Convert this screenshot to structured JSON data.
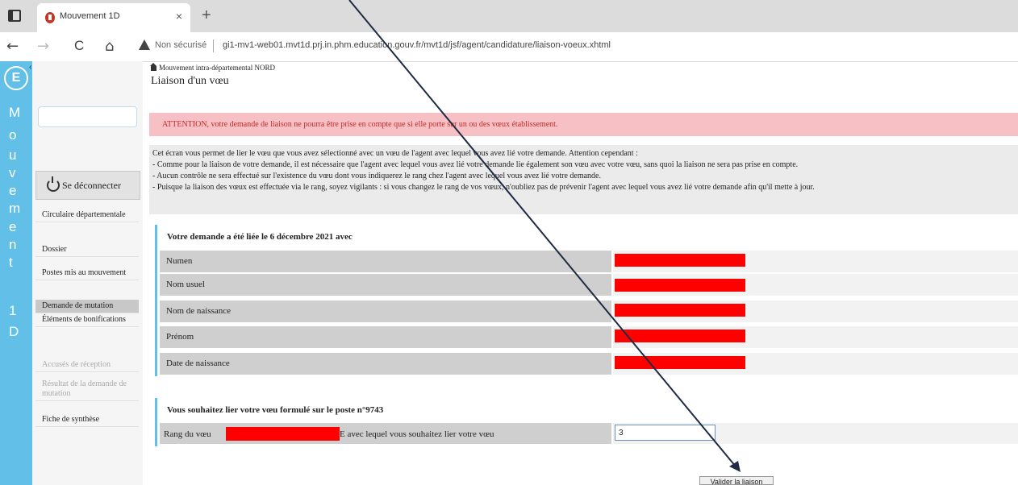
{
  "browser": {
    "tab_title": "Mouvement 1D",
    "tab_close": "×",
    "new_tab": "+",
    "nav_back": "←",
    "nav_forward": "→",
    "nav_reload": "C",
    "nav_home": "⌂",
    "security_label": "Non sécurisé",
    "url": "gi1-mv1-web01.mvt1d.prj.in.phm.education.gouv.fr/mvt1d/jsf/agent/candidature/liaison-voeux.xhtml"
  },
  "strip": {
    "logo": "E",
    "collapse": "‹",
    "letters": [
      "M",
      "o",
      "u",
      "v",
      "e",
      "m",
      "e",
      "n",
      "t",
      "1",
      "D"
    ]
  },
  "sidebar": {
    "logout_label": "Se déconnecter",
    "items": [
      {
        "label": "Circulaire départementale",
        "state": "normal"
      },
      {
        "label": "Dossier",
        "state": "normal"
      },
      {
        "label": "Postes mis au mouvement",
        "state": "normal"
      },
      {
        "label": "Demande de mutation",
        "state": "active"
      },
      {
        "label": "Éléments de bonifications",
        "state": "normal"
      },
      {
        "label": "Accusés de réception",
        "state": "disabled"
      },
      {
        "label": "Résultat de la demande de mutation",
        "state": "disabled"
      },
      {
        "label": "Fiche de synthèse",
        "state": "normal"
      }
    ]
  },
  "page": {
    "breadcrumb": "Mouvement intra-départemental NORD",
    "title": "Liaison d'un vœu",
    "alert": "ATTENTION, votre demande de liaison ne pourra être prise en compte que si elle porte sur un ou des vœux établissement.",
    "info_lines": [
      "Cet écran vous permet de lier le vœu que vous avez sélectionné avec un vœu de l'agent avec lequel vous avez lié votre demande. Attention cependant :",
      "- Comme pour la liaison de votre demande, il est nécessaire que l'agent avec lequel vous avez lié votre demande lie également son vœu avec votre vœu, sans quoi la liaison ne sera pas prise en compte.",
      "- Aucun contrôle ne sera effectué sur l'existence du vœu dont vous indiquerez le rang chez l'agent avec lequel vous avez lié votre demande.",
      "- Puisque la liaison des vœux est effectuée via le rang, soyez vigilants : si vous changez le rang de vos vœux, n'oubliez pas de prévenir l'agent avec lequel vous avez lié votre demande afin qu'il mette à jour."
    ],
    "linked_section": {
      "heading": "Votre demande a été liée le 6 décembre 2021 avec",
      "rows": [
        {
          "label": "Numen"
        },
        {
          "label": "Nom usuel"
        },
        {
          "label": "Nom de naissance"
        },
        {
          "label": "Prénom"
        },
        {
          "label": "Date de naissance"
        }
      ]
    },
    "link_section": {
      "heading": "Vous souhaitez lier votre vœu formulé sur le poste n°9743",
      "rang_prefix": "Rang du vœu",
      "rang_suffix": "E avec lequel vous souhaitez lier votre vœu",
      "rang_value": "3"
    },
    "submit_label": "Valider la liaison"
  },
  "colors": {
    "strip": "#62c0e8",
    "alert_bg": "#f7c0c4",
    "alert_text": "#c12b2b",
    "redaction": "#ff0000"
  }
}
